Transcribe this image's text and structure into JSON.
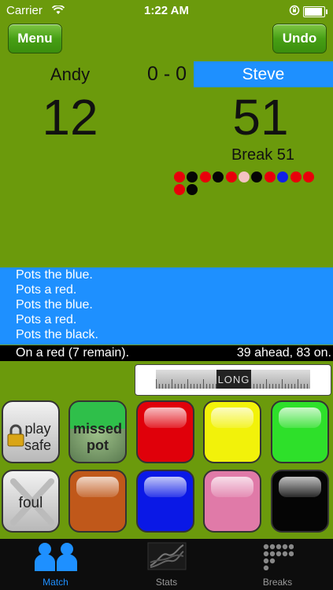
{
  "status_bar": {
    "carrier": "Carrier",
    "time": "1:22 AM"
  },
  "toolbar": {
    "menu_label": "Menu",
    "undo_label": "Undo"
  },
  "match": {
    "player_left": "Andy",
    "player_right": "Steve",
    "frames": "0 - 0",
    "score_left": "12",
    "score_right": "51",
    "break_text": "Break 51",
    "break_balls": [
      "red",
      "black",
      "red",
      "black",
      "red",
      "pink",
      "black",
      "red",
      "blue",
      "red",
      "red",
      "red",
      "black"
    ]
  },
  "commentary": {
    "lines": [
      "Pots the blue.",
      "Pots a red.",
      "Pots the blue.",
      "Pots a red.",
      "Pots the black."
    ],
    "status_left": "On a red (7 remain).",
    "status_right": "39 ahead, 83 on."
  },
  "shot_slider": {
    "value_label": "LONG"
  },
  "buttons": {
    "play_safe": "play safe",
    "missed_pot": "missed pot",
    "foul": "foul",
    "colors": {
      "red": "#e0000a",
      "yellow": "#f2f20a",
      "green": "#2ee02a",
      "brown": "#c0581a",
      "blue": "#0a18e6",
      "pink": "#e07aa8",
      "black": "#050505"
    }
  },
  "tabs": [
    {
      "label": "Match",
      "active": true
    },
    {
      "label": "Stats",
      "active": false
    },
    {
      "label": "Breaks",
      "active": false
    }
  ],
  "colors": {
    "table_green": "#6b9a0c",
    "highlight_blue": "#1e90ff"
  }
}
